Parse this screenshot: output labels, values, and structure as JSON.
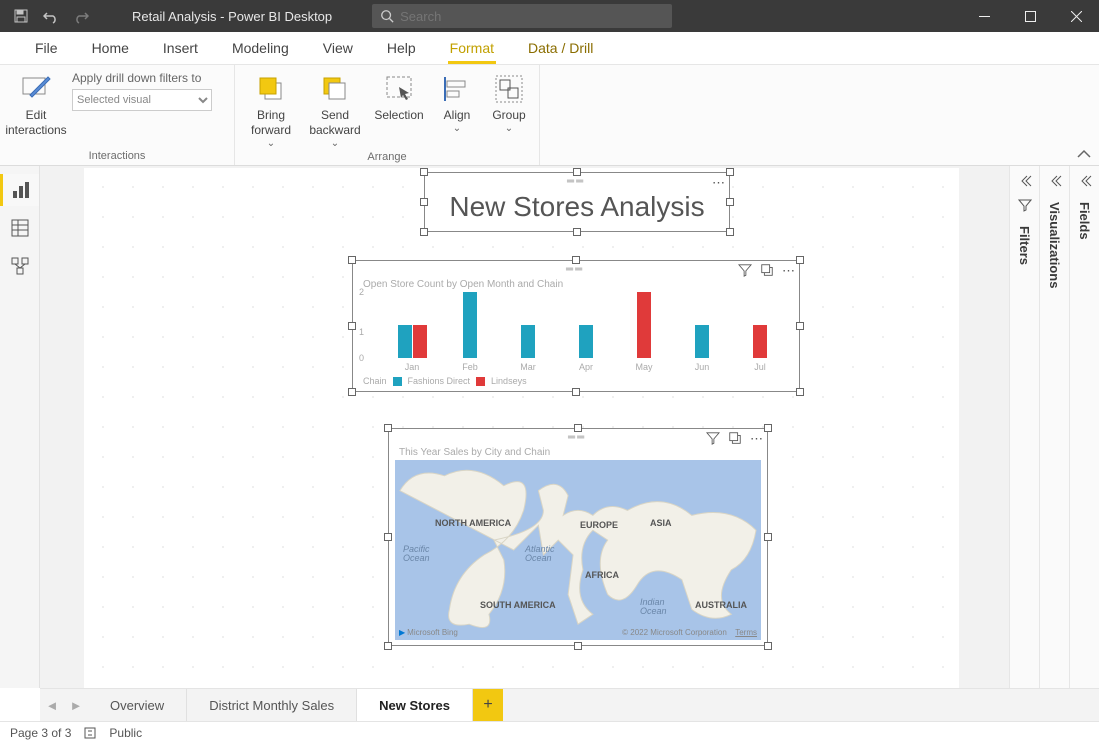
{
  "app_title": "Retail Analysis - Power BI Desktop",
  "search": {
    "placeholder": "Search"
  },
  "menu": {
    "file": "File",
    "home": "Home",
    "insert": "Insert",
    "modeling": "Modeling",
    "view": "View",
    "help": "Help",
    "format": "Format",
    "datadrill": "Data / Drill"
  },
  "ribbon": {
    "interactions": {
      "edit_interactions": "Edit\ninteractions",
      "apply_label": "Apply drill down filters to",
      "selected_visual": "Selected visual",
      "group_label": "Interactions"
    },
    "arrange": {
      "bring_forward": "Bring\nforward",
      "send_backward": "Send\nbackward",
      "selection": "Selection",
      "align": "Align",
      "group": "Group",
      "group_label": "Arrange"
    }
  },
  "panes": {
    "filters": "Filters",
    "visualizations": "Visualizations",
    "fields": "Fields"
  },
  "canvas": {
    "title_visual": "New Stores Analysis",
    "bar": {
      "title": "Open Store Count by Open Month and Chain",
      "legend_label": "Chain",
      "series_a": "Fashions Direct",
      "series_b": "Lindseys",
      "ymax": "2",
      "ymid": "1",
      "ymin": "0"
    },
    "map": {
      "title": "This Year Sales by City and Chain",
      "na": "NORTH AMERICA",
      "sa": "SOUTH AMERICA",
      "eu": "EUROPE",
      "af": "AFRICA",
      "as": "ASIA",
      "au": "AUSTRALIA",
      "pacific": "Pacific\nOcean",
      "atlantic": "Atlantic\nOcean",
      "indian": "Indian\nOcean",
      "bing": "Microsoft Bing",
      "copyright": "© 2022 Microsoft Corporation",
      "terms": "Terms"
    }
  },
  "chart_data": {
    "type": "bar",
    "title": "Open Store Count by Open Month and Chain",
    "xlabel": "Open Month",
    "ylabel": "Open Store Count",
    "ylim": [
      0,
      2
    ],
    "categories": [
      "Jan",
      "Feb",
      "Mar",
      "Apr",
      "May",
      "Jun",
      "Jul"
    ],
    "series": [
      {
        "name": "Fashions Direct",
        "color": "#1fa2bf",
        "values": [
          1,
          2,
          1,
          1,
          0,
          1,
          0
        ]
      },
      {
        "name": "Lindseys",
        "color": "#e03a3a",
        "values": [
          1,
          0,
          0,
          0,
          2,
          0,
          1
        ]
      }
    ]
  },
  "page_tabs": {
    "overview": "Overview",
    "dms": "District Monthly Sales",
    "newstores": "New Stores"
  },
  "status": {
    "page": "Page 3 of 3",
    "public": "Public"
  }
}
